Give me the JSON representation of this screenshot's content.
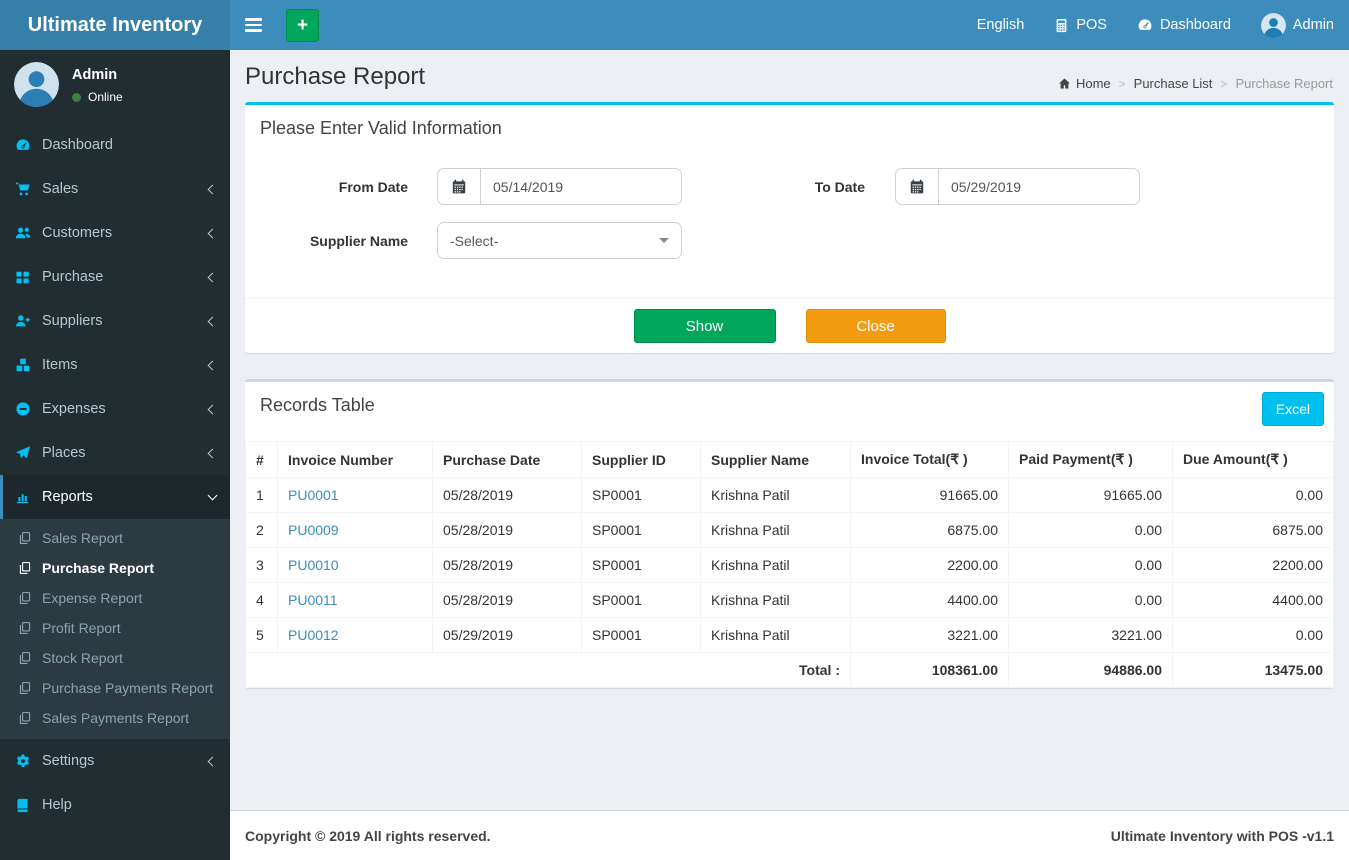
{
  "app": {
    "brand": "Ultimate Inventory"
  },
  "navbar": {
    "add_label": "+",
    "language": "English",
    "pos": "POS",
    "dashboard": "Dashboard",
    "user": "Admin"
  },
  "sidebar": {
    "user_name": "Admin",
    "user_status": "Online",
    "items": [
      {
        "label": "Dashboard"
      },
      {
        "label": "Sales"
      },
      {
        "label": "Customers"
      },
      {
        "label": "Purchase"
      },
      {
        "label": "Suppliers"
      },
      {
        "label": "Items"
      },
      {
        "label": "Expenses"
      },
      {
        "label": "Places"
      },
      {
        "label": "Reports"
      },
      {
        "label": "Settings"
      },
      {
        "label": "Help"
      }
    ],
    "reports_submenu": [
      "Sales Report",
      "Purchase Report",
      "Expense Report",
      "Profit Report",
      "Stock Report",
      "Purchase Payments Report",
      "Sales Payments Report"
    ]
  },
  "page": {
    "title": "Purchase Report",
    "breadcrumb_home": "Home",
    "breadcrumb_mid": "Purchase List",
    "breadcrumb_current": "Purchase Report",
    "sep": ">"
  },
  "filter_card": {
    "title": "Please Enter Valid Information",
    "from_date_label": "From Date",
    "from_date_value": "05/14/2019",
    "to_date_label": "To Date",
    "to_date_value": "05/29/2019",
    "supplier_label": "Supplier Name",
    "supplier_value": "-Select-",
    "show_label": "Show",
    "close_label": "Close"
  },
  "records_card": {
    "title": "Records Table",
    "excel": "Excel",
    "headers": [
      "#",
      "Invoice Number",
      "Purchase Date",
      "Supplier ID",
      "Supplier Name",
      "Invoice Total(₹ )",
      "Paid Payment(₹ )",
      "Due Amount(₹ )"
    ],
    "rows": [
      [
        "1",
        "PU0001",
        "05/28/2019",
        "SP0001",
        "Krishna Patil",
        "91665.00",
        "91665.00",
        "0.00"
      ],
      [
        "2",
        "PU0009",
        "05/28/2019",
        "SP0001",
        "Krishna Patil",
        "6875.00",
        "0.00",
        "6875.00"
      ],
      [
        "3",
        "PU0010",
        "05/28/2019",
        "SP0001",
        "Krishna Patil",
        "2200.00",
        "0.00",
        "2200.00"
      ],
      [
        "4",
        "PU0011",
        "05/28/2019",
        "SP0001",
        "Krishna Patil",
        "4400.00",
        "0.00",
        "4400.00"
      ],
      [
        "5",
        "PU0012",
        "05/29/2019",
        "SP0001",
        "Krishna Patil",
        "3221.00",
        "3221.00",
        "0.00"
      ]
    ],
    "total_label": "Total :",
    "totals": [
      "108361.00",
      "94886.00",
      "13475.00"
    ]
  },
  "footer": {
    "left": "Copyright © 2019 All rights reserved.",
    "right": "Ultimate Inventory with POS -v1.1"
  },
  "colors": {
    "navbar": "#3c8dbc",
    "brand_bg": "#367fa9",
    "sidebar_bg": "#222d32",
    "submenu_bg": "#2c3b41",
    "accent_cyan": "#00c0ef",
    "green": "#00a65a",
    "orange": "#f39c12",
    "link": "#3c8dbc",
    "content_bg": "#ecf0f5"
  },
  "icons": [
    "menu-icon",
    "plus-icon",
    "calculator-icon",
    "dashboard-icon",
    "user-avatar-icon",
    "cart-icon",
    "users-icon",
    "grid-icon",
    "user-plus-icon",
    "cubes-icon",
    "minus-circle-icon",
    "paper-plane-icon",
    "bar-chart-icon",
    "copy-icon",
    "gears-icon",
    "book-icon",
    "home-icon",
    "calendar-icon",
    "chevron-left-icon",
    "chevron-down-icon",
    "caret-down-icon"
  ]
}
